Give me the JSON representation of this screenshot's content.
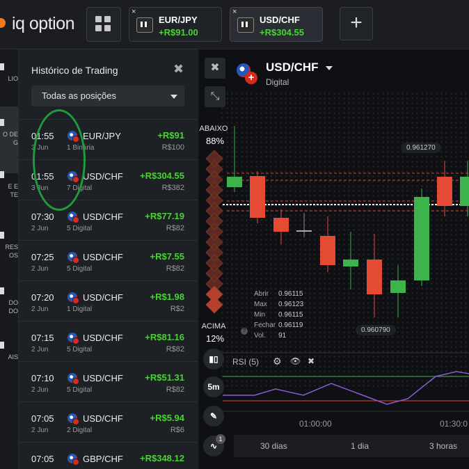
{
  "topbar": {
    "logo": "iq option",
    "tabs": [
      {
        "symbol": "EUR/JPY",
        "pnl": "+R$91.00",
        "close": "×"
      },
      {
        "symbol": "USD/CHF",
        "pnl": "+R$304.55",
        "close": "×"
      }
    ],
    "add": "+"
  },
  "leftnav": [
    {
      "label": "LIO"
    },
    {
      "label": "O DE G"
    },
    {
      "label": "E E TE"
    },
    {
      "label": "RES OS"
    },
    {
      "label": "DO DO"
    },
    {
      "label": "AIS"
    }
  ],
  "history": {
    "title": "Histórico de Trading",
    "close": "✖",
    "filter": "Todas as posições",
    "rows": [
      {
        "time": "01:55",
        "date": "3 Jun",
        "asset": "EUR/JPY",
        "sub": "1 Binária",
        "profit": "+R$91",
        "invest": "R$100"
      },
      {
        "time": "01:55",
        "date": "3 Jun",
        "asset": "USD/CHF",
        "sub": "7 Digital",
        "profit": "+R$304.55",
        "invest": "R$382"
      },
      {
        "time": "07:30",
        "date": "2 Jun",
        "asset": "USD/CHF",
        "sub": "5 Digital",
        "profit": "+R$77.19",
        "invest": "R$82"
      },
      {
        "time": "07:25",
        "date": "2 Jun",
        "asset": "USD/CHF",
        "sub": "5 Digital",
        "profit": "+R$7.55",
        "invest": "R$82"
      },
      {
        "time": "07:20",
        "date": "2 Jun",
        "asset": "USD/CHF",
        "sub": "1 Digital",
        "profit": "+R$1.98",
        "invest": "R$2"
      },
      {
        "time": "07:15",
        "date": "2 Jun",
        "asset": "USD/CHF",
        "sub": "5 Digital",
        "profit": "+R$81.16",
        "invest": "R$82"
      },
      {
        "time": "07:10",
        "date": "2 Jun",
        "asset": "USD/CHF",
        "sub": "5 Digital",
        "profit": "+R$51.31",
        "invest": "R$82"
      },
      {
        "time": "07:05",
        "date": "2 Jun",
        "asset": "USD/CHF",
        "sub": "2 Digital",
        "profit": "+R$5.94",
        "invest": "R$6"
      },
      {
        "time": "07:05",
        "date": "",
        "asset": "GBP/CHF",
        "sub": "",
        "profit": "+R$348.12",
        "invest": ""
      }
    ]
  },
  "chart": {
    "close": "✖",
    "collapse": "⤡",
    "pair": "USD/CHF",
    "pair_type": "Digital",
    "below_label": "ABAIXO",
    "below_pct": "88%",
    "above_label": "ACIMA",
    "above_pct": "12%",
    "price_high_tag": "0.961270",
    "price_low_tag": "0.960790",
    "ohlc": {
      "open_label": "Abrir",
      "open": "0.96115",
      "max_label": "Max",
      "max": "0.96123",
      "min_label": "Min",
      "min": "0.96115",
      "close_label": "Fechar",
      "close": "0.96119",
      "vol_label": "Vol.",
      "vol": "91"
    },
    "indicator": "RSI (5)",
    "timeframe": "5m",
    "badge": "1",
    "time_labels": [
      "01:00:00",
      "01:30:0"
    ],
    "periods": [
      "30 dias",
      "1 dia",
      "3 horas"
    ]
  }
}
